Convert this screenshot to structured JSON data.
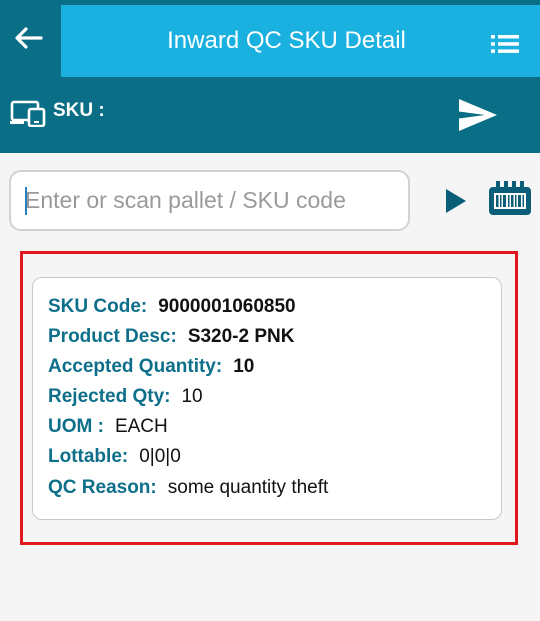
{
  "header": {
    "title": "Inward QC SKU Detail",
    "back_icon": "arrow-left-icon",
    "menu_icon": "list-icon"
  },
  "sku_bar": {
    "label": "SKU :",
    "device_icon": "devices-icon",
    "send_icon": "send-icon"
  },
  "search": {
    "placeholder": "Enter or scan pallet / SKU code",
    "value": "",
    "play_icon": "play-icon",
    "barcode_icon": "barcode-scanner-icon"
  },
  "details": {
    "sku_code_label": "SKU Code:",
    "sku_code": "9000001060850",
    "product_desc_label": "Product Desc:",
    "product_desc": "S320-2 PNK",
    "accepted_qty_label": "Accepted Quantity:",
    "accepted_qty": "10",
    "rejected_qty_label": "Rejected Qty:",
    "rejected_qty": "10",
    "uom_label": "UOM :",
    "uom": "EACH",
    "lottable_label": "Lottable:",
    "lottable": "0|0|0",
    "qc_reason_label": "QC Reason:",
    "qc_reason": "some quantity theft"
  },
  "colors": {
    "primary_dark": "#0a6e87",
    "primary_light": "#1ab0df",
    "label_teal": "#0d6f8a",
    "highlight_red": "#e0191e",
    "icon_blue": "#0b5e78"
  }
}
